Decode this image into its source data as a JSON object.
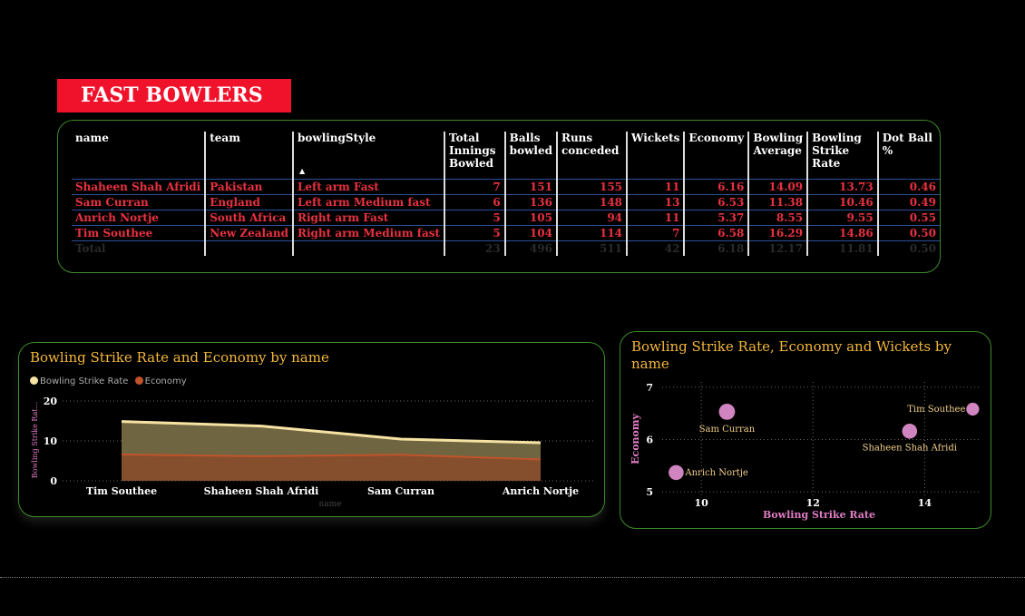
{
  "banner": {
    "title": "FAST BOWLERS"
  },
  "table": {
    "columns": [
      [
        "name"
      ],
      [
        "team"
      ],
      [
        "bowlingStyle"
      ],
      [
        "Total",
        "Innings",
        "Bowled"
      ],
      [
        "Balls",
        "bowled"
      ],
      [
        "Runs",
        "conceded"
      ],
      [
        "Wickets"
      ],
      [
        "Economy"
      ],
      [
        "Bowling",
        "Average"
      ],
      [
        "Bowling",
        "Strike Rate"
      ],
      [
        "Dot Ball %"
      ]
    ],
    "rows": [
      [
        "Shaheen Shah Afridi",
        "Pakistan",
        "Left arm Fast",
        "7",
        "151",
        "155",
        "11",
        "6.16",
        "14.09",
        "13.73",
        "0.46"
      ],
      [
        "Sam Curran",
        "England",
        "Left arm Medium fast",
        "6",
        "136",
        "148",
        "13",
        "6.53",
        "11.38",
        "10.46",
        "0.49"
      ],
      [
        "Anrich Nortje",
        "South Africa",
        "Right arm Fast",
        "5",
        "105",
        "94",
        "11",
        "5.37",
        "8.55",
        "9.55",
        "0.55"
      ],
      [
        "Tim Southee",
        "New Zealand",
        "Right arm Medium fast",
        "5",
        "104",
        "114",
        "7",
        "6.58",
        "16.29",
        "14.86",
        "0.50"
      ]
    ],
    "total": [
      "Total",
      "",
      "",
      "23",
      "496",
      "511",
      "42",
      "6.18",
      "12.17",
      "11.81",
      "0.50"
    ]
  },
  "colors": {
    "accent_red": "#e8313f",
    "banner_red": "#f0122b",
    "title_gold": "#f3b63a",
    "panel_border": "#3c8a2a",
    "strike_rate": "#f6e3a3",
    "economy": "#c0532b",
    "scatter_point": "#d084c0",
    "axis_title_pink": "#e07cc4"
  },
  "chart_data": [
    {
      "type": "area",
      "title": "Bowling Strike Rate and Economy by name",
      "xlabel": "name",
      "ylabel": "Bowling Strike Rat...",
      "categories": [
        "Tim Southee",
        "Shaheen Shah Afridi",
        "Sam Curran",
        "Anrich Nortje"
      ],
      "series": [
        {
          "name": "Bowling Strike Rate",
          "values": [
            14.86,
            13.73,
            10.46,
            9.55
          ]
        },
        {
          "name": "Economy",
          "values": [
            6.58,
            6.16,
            6.53,
            5.37
          ]
        }
      ],
      "yticks": [
        "20",
        "10",
        "0"
      ],
      "ylim": [
        0,
        20
      ],
      "grid": true,
      "legend": "top-left"
    },
    {
      "type": "scatter",
      "title": "Bowling Strike Rate, Economy and Wickets by name",
      "xlabel": "Bowling Strike Rate",
      "ylabel": "Economy",
      "xticks": [
        "10",
        "12",
        "14"
      ],
      "yticks": [
        "7",
        "6",
        "5"
      ],
      "xlim": [
        9.3,
        15
      ],
      "ylim": [
        4.9,
        7.1
      ],
      "grid": true,
      "points": [
        {
          "label": "Sam Curran",
          "x": 10.46,
          "y": 6.53,
          "size": 13
        },
        {
          "label": "Tim Southee",
          "x": 14.86,
          "y": 6.58,
          "size": 7
        },
        {
          "label": "Shaheen Shah Afridi",
          "x": 13.73,
          "y": 6.16,
          "size": 11
        },
        {
          "label": "Anrich Nortje",
          "x": 9.55,
          "y": 5.37,
          "size": 11
        }
      ]
    }
  ]
}
